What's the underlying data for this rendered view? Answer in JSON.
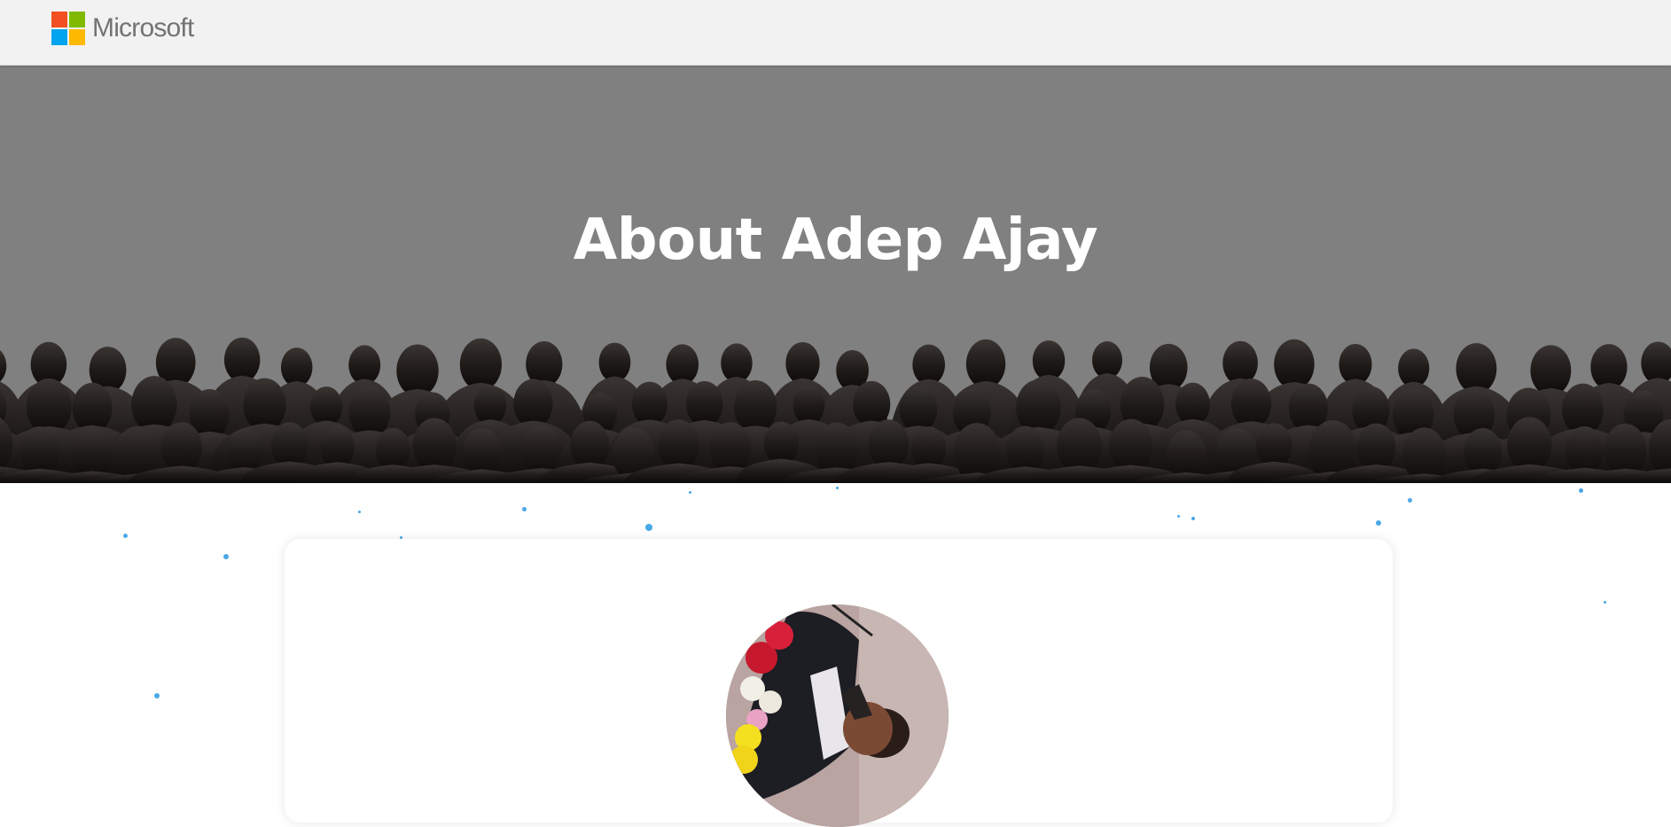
{
  "header": {
    "brand": "Microsoft",
    "logo_colors": [
      "#f25022",
      "#7fba00",
      "#00a4ef",
      "#ffb900"
    ]
  },
  "hero": {
    "title": "About Adep Ajay",
    "background_color": "#808080"
  },
  "profile": {
    "avatar_icon": "profile-photo"
  },
  "colors": {
    "accent_dots": "#4aa8e8"
  }
}
